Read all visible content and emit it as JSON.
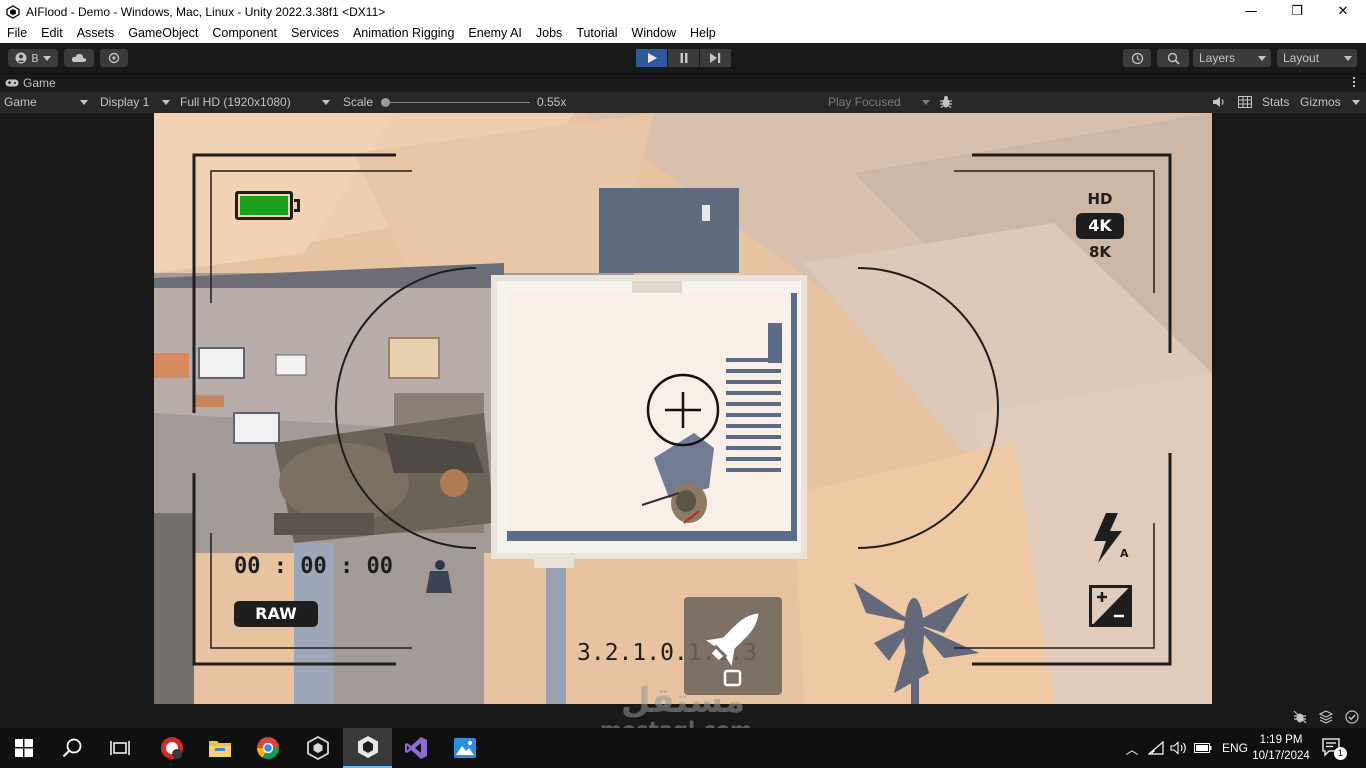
{
  "window": {
    "title": "AIFlood - Demo - Windows, Mac, Linux - Unity 2022.3.38f1 <DX11>",
    "minimize": "—",
    "maximize": "❐",
    "close": "✕"
  },
  "menu": [
    "File",
    "Edit",
    "Assets",
    "GameObject",
    "Component",
    "Services",
    "Animation Rigging",
    "Enemy AI",
    "Jobs",
    "Tutorial",
    "Window",
    "Help"
  ],
  "toolbar": {
    "account_label": "B",
    "layers_label": "Layers",
    "layout_label": "Layout"
  },
  "game_tab": {
    "label": "Game"
  },
  "game_controls": {
    "view_mode": "Game",
    "display": "Display 1",
    "resolution": "Full HD (1920x1080)",
    "scale_label": "Scale",
    "scale_value": "0.55x",
    "scale_fraction": 0.0,
    "play_focused": "Play Focused",
    "stats": "Stats",
    "gizmos": "Gizmos"
  },
  "hud": {
    "quality_options": [
      "HD",
      "4K",
      "8K"
    ],
    "selected_quality": "4K",
    "timer": "00 : 00 : 00",
    "raw_label": "RAW",
    "ruler": "3.2.1.0.1.2.3",
    "battery_level": 1.0
  },
  "watermark": {
    "arabic": "مستقل",
    "latin": "mostaql.com"
  },
  "taskbar": {
    "lang": "ENG",
    "time": "1:19 PM",
    "date": "10/17/2024",
    "notifications": "1"
  },
  "colors": {
    "play_active": "#2e5a9a",
    "battery_fill": "#17a11d",
    "sand": "#e9c7a6"
  }
}
